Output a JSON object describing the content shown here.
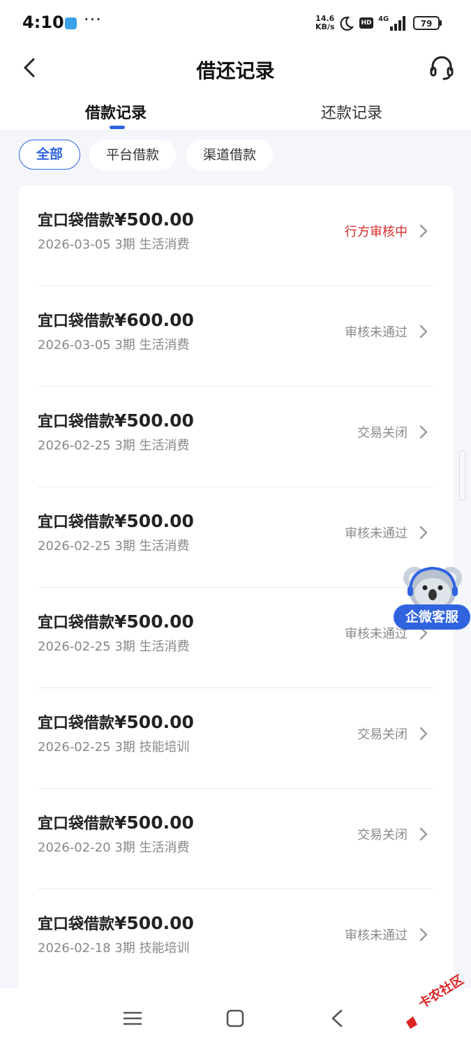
{
  "status_bar": {
    "time": "4:10",
    "dots": "···",
    "net_speed": "14.6",
    "net_unit": "KB/s",
    "hd": "HD",
    "network": "4G",
    "battery": "79"
  },
  "header": {
    "title": "借还记录"
  },
  "tabs": [
    {
      "label": "借款记录",
      "active": true
    },
    {
      "label": "还款记录",
      "active": false
    }
  ],
  "filters": [
    {
      "label": "全部",
      "selected": true
    },
    {
      "label": "平台借款",
      "selected": false
    },
    {
      "label": "渠道借款",
      "selected": false
    }
  ],
  "records": [
    {
      "name": "宜口袋借款",
      "amount": "¥500.00",
      "meta": "2026-03-05 3期  生活消费",
      "status": "行方审核中",
      "status_color": "#d92b2b"
    },
    {
      "name": "宜口袋借款",
      "amount": "¥600.00",
      "meta": "2026-03-05 3期  生活消费",
      "status": "审核未通过",
      "status_color": "#8a8a8a"
    },
    {
      "name": "宜口袋借款",
      "amount": "¥500.00",
      "meta": "2026-02-25 3期  生活消费",
      "status": "交易关闭",
      "status_color": "#8a8a8a"
    },
    {
      "name": "宜口袋借款",
      "amount": "¥500.00",
      "meta": "2026-02-25 3期  生活消费",
      "status": "审核未通过",
      "status_color": "#8a8a8a"
    },
    {
      "name": "宜口袋借款",
      "amount": "¥500.00",
      "meta": "2026-02-25 3期  生活消费",
      "status": "审核未通过",
      "status_color": "#8a8a8a"
    },
    {
      "name": "宜口袋借款",
      "amount": "¥500.00",
      "meta": "2026-02-25 3期  技能培训",
      "status": "交易关闭",
      "status_color": "#8a8a8a"
    },
    {
      "name": "宜口袋借款",
      "amount": "¥500.00",
      "meta": "2026-02-20 3期  生活消费",
      "status": "交易关闭",
      "status_color": "#8a8a8a"
    },
    {
      "name": "宜口袋借款",
      "amount": "¥500.00",
      "meta": "2026-02-18 3期  技能培训",
      "status": "审核未通过",
      "status_color": "#8a8a8a"
    }
  ],
  "floating_service": {
    "label": "企微客服"
  },
  "watermark": {
    "text": "卡农社区"
  },
  "colors": {
    "accent": "#2f63e0",
    "danger": "#d92b2b",
    "muted": "#8a8a8a"
  }
}
